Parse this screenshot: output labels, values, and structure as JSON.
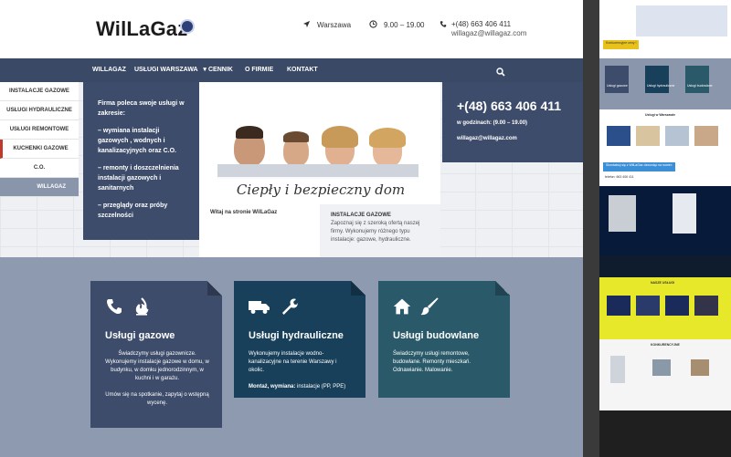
{
  "header": {
    "logo": "WilLaGaz",
    "location": "Warszawa",
    "hours": "9.00 – 19.00",
    "phone": "+(48) 663 406 411",
    "email": "willagaz@willagaz.com"
  },
  "nav": {
    "items": [
      "WILLAGAZ",
      "USŁUGI WARSZAWA",
      "CENNIK",
      "O FIRMIE",
      "KONTAKT"
    ],
    "dropdown_icon": "chevron-down-icon",
    "search_icon": "search-icon"
  },
  "side_menu": {
    "items": [
      "INSTALACJE GAZOWE",
      "USŁUGI HYDRAULICZNE",
      "USŁUGI REMONTOWE",
      "KUCHENKI GAZOWE",
      "C.O.",
      "WILLAGAZ"
    ]
  },
  "blue_panel": {
    "intro": "Firma poleca swoje usługi w zakresie:",
    "points": [
      "– wymiana instalacji gazowych , wodnych i kanalizacyjnych oraz C.O.",
      "– remonty i doszczelnienia instalacji gazowych i sanitarnych",
      "– przeglądy oraz próby szczelności"
    ]
  },
  "hero": {
    "banner": "Ciepły i bezpieczny dom",
    "welcome": "Witaj na stronie WilLaGaz",
    "box_title": "INSTALACJE GAZOWE",
    "box_text": "Zapoznaj się z szeroką ofertą naszej firmy. Wykonujemy różnego typu instalacje: gazowe, hydrauliczne."
  },
  "phone_panel": {
    "phone": "+(48) 663 406 411",
    "hours": "w godzinach: (9.00 – 19.00)",
    "email": "willagaz@willagaz.com"
  },
  "cards": [
    {
      "title": "Usługi gazowe",
      "icons": [
        "phone-icon",
        "flame-icon"
      ],
      "body": "Świadczymy usługi gazownicze. Wykonujemy instalacje gazowe w domu, w budynku, w domku jednorodzinnym, w kuchni i w garażu.",
      "body2": "Umów się na spotkanie, zapytaj o wstępną wycenę."
    },
    {
      "title": "Usługi hydrauliczne",
      "icons": [
        "truck-icon",
        "wrench-icon"
      ],
      "body": "Wykonujemy instalacje wodno-kanalizacyjne na terenie Warszawy i okolic.",
      "body2_bold": "Montaż, wymiana:",
      "body2": " instalacje (PP, PPE)"
    },
    {
      "title": "Usługi budowlane",
      "icons": [
        "house-icon",
        "brush-icon"
      ],
      "body": "Świadczymy usługi remontowe, budowlane. Remonty mieszkań. Odnawianie. Malowanie."
    }
  ],
  "strip": {
    "s3_title": "Usługi w Warszawie",
    "s4_banner": "Skontaktuj się z WilLaGaz dzwoniąc na numer:",
    "s4_phone": "telefon: 663 406 411",
    "s7_title": "NASZE USŁUGI",
    "s8_title": "KONKURENCYJNE",
    "mini_btn": "Konkurencyjne ceny !",
    "tiles": [
      "Usługi gazowe",
      "Usługi hydrauliczne",
      "Usługi budowlane"
    ]
  },
  "colors": {
    "navy": "#3d4c6a",
    "nav_bg": "#3a4a66",
    "band": "#8e9ab0",
    "card_teal_dark": "#18405a",
    "card_teal": "#2a5a6a"
  }
}
